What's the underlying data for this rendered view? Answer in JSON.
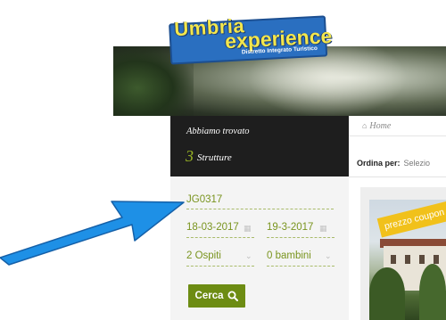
{
  "logo": {
    "line1": "Umbria",
    "line2": "experience",
    "tagline": "Distretto Integrato Turistico"
  },
  "results": {
    "found_text": "Abbiamo trovato",
    "count": "3",
    "label": "Strutture"
  },
  "breadcrumb": {
    "home": "Home"
  },
  "sort": {
    "label": "Ordina per:",
    "selected": "Selezio"
  },
  "search": {
    "code_value": "JG0317",
    "checkin": "18-03-2017",
    "checkout": "19-3-2017",
    "guests": "2 Ospiti",
    "children": "0 bambini",
    "button_label": "Cerca"
  },
  "card": {
    "badge": "prezzo coupon"
  },
  "colors": {
    "accent_green": "#6d8c13",
    "field_text": "#79941e",
    "badge_yellow": "#f1c11b",
    "arrow_blue": "#1e90e6",
    "dark_panel": "#1e1e1e"
  },
  "icons": {
    "home": "home-icon",
    "calendar": "calendar-icon",
    "chevron": "chevron-down-icon",
    "search": "search-icon",
    "arrow": "annotation-arrow"
  }
}
